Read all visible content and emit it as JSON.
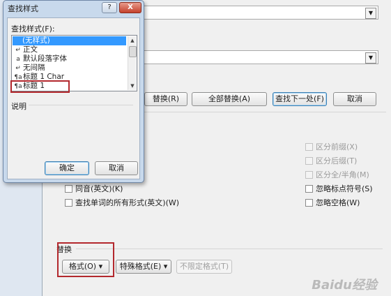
{
  "replace_dialog": {
    "find_options": {
      "checkbox_prefix": "区分前缀(X)",
      "checkbox_suffix": "区分后缀(T)",
      "checkbox_fullhalf": "区分全/半角(M)",
      "checkbox_punct": "忽略标点符号(S)",
      "checkbox_space": "忽略空格(W)",
      "checkbox_homophone": "同音(英文)(K)",
      "checkbox_allforms": "查找单词的所有形式(英文)(W)"
    },
    "buttons": {
      "replace": "替换(R)",
      "replace_all": "全部替换(A)",
      "find_next": "查找下一处(F)",
      "cancel": "取消"
    },
    "replace_section": {
      "label": "替换",
      "format": "格式(O) ▾",
      "special": "特殊格式(E) ▾",
      "no_format": "不限定格式(T)"
    }
  },
  "find_style_dialog": {
    "title": "查找样式",
    "help": "?",
    "close": "X",
    "list_label": "查找样式(F):",
    "styles": [
      {
        "icon": "",
        "label": "(无样式)",
        "selected": true
      },
      {
        "icon": "↵",
        "label": "正文",
        "selected": false
      },
      {
        "icon": "a",
        "label": "默认段落字体",
        "selected": false
      },
      {
        "icon": "↵",
        "label": "无间隔",
        "selected": false
      },
      {
        "icon": "¶a",
        "label": "标题 1 Char",
        "selected": false
      },
      {
        "icon": "¶a",
        "label": "标题 1",
        "selected": false
      }
    ],
    "description_label": "说明",
    "ok": "确定",
    "cancel": "取消"
  },
  "watermark": "Baidu经验",
  "colors": {
    "highlight": "#b3282d",
    "selection": "#3399ff"
  }
}
